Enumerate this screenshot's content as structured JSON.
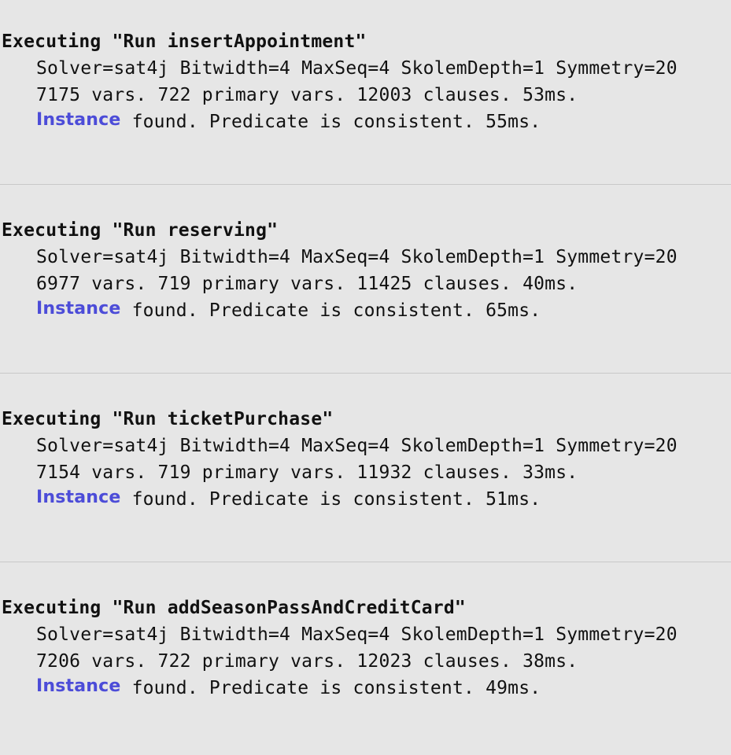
{
  "runs": [
    {
      "heading": "Executing \"Run insertAppointment\"",
      "solver_line": "Solver=sat4j Bitwidth=4 MaxSeq=4 SkolemDepth=1 Symmetry=20",
      "stats_line": "7175 vars. 722 primary vars. 12003 clauses. 53ms.",
      "instance_link": "Instance",
      "result_text": " found. Predicate is consistent. 55ms."
    },
    {
      "heading": "Executing \"Run reserving\"",
      "solver_line": "Solver=sat4j Bitwidth=4 MaxSeq=4 SkolemDepth=1 Symmetry=20",
      "stats_line": "6977 vars. 719 primary vars. 11425 clauses. 40ms.",
      "instance_link": "Instance",
      "result_text": " found. Predicate is consistent. 65ms."
    },
    {
      "heading": "Executing \"Run ticketPurchase\"",
      "solver_line": "Solver=sat4j Bitwidth=4 MaxSeq=4 SkolemDepth=1 Symmetry=20",
      "stats_line": "7154 vars. 719 primary vars. 11932 clauses. 33ms.",
      "instance_link": "Instance",
      "result_text": " found. Predicate is consistent. 51ms."
    },
    {
      "heading": "Executing \"Run addSeasonPassAndCreditCard\"",
      "solver_line": "Solver=sat4j Bitwidth=4 MaxSeq=4 SkolemDepth=1 Symmetry=20",
      "stats_line": "7206 vars. 722 primary vars. 12023 clauses. 38ms.",
      "instance_link": "Instance",
      "result_text": " found. Predicate is consistent. 49ms."
    }
  ],
  "colors": {
    "background": "#e6e6e6",
    "text": "#111111",
    "link": "#4c4cd8",
    "separator": "#c8c8c8"
  }
}
